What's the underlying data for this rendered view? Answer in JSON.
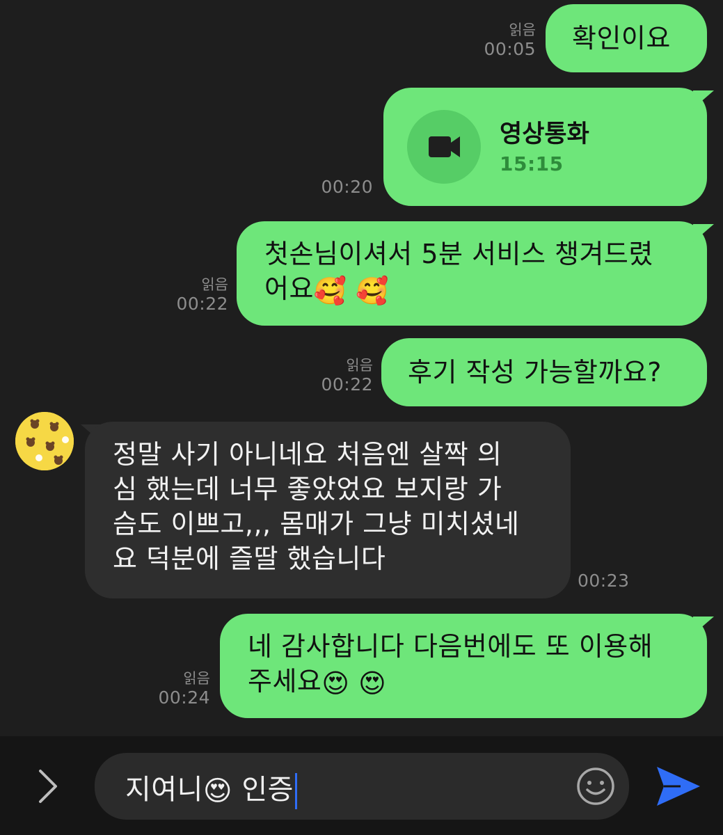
{
  "messages": [
    {
      "text": "확인이요",
      "read": "읽음",
      "time": "00:05"
    },
    {
      "call_title": "영상통화",
      "call_duration": "15:15",
      "time": "00:20"
    },
    {
      "line1": "첫손님이셔서 5분 서비스 챙겨드렸",
      "line2": "어요",
      "emoji": "🥰",
      "read": "읽음",
      "time": "00:22"
    },
    {
      "text": "후기 작성 가능할까요?",
      "read": "읽음",
      "time": "00:22"
    },
    {
      "line1": "정말 사기 아니네요 처음엔 살짝 의",
      "line2": "심 했는데 너무 좋았었요 보지랑 가",
      "line3": "슴도 이쁘고,,, 몸매가 그냥 미치셨네",
      "line4": "요 덕분에 즐딸 했습니다",
      "time": "00:23"
    },
    {
      "line1": "네 감사합니다 다음번에도 또 이용해",
      "line2": "주세요",
      "emoji": "😍",
      "read": "읽음",
      "time": "00:24"
    }
  ],
  "input": {
    "text_before": "지여니",
    "emoji": "😍",
    "text_after": "인증"
  },
  "icons": {
    "expand": "chevron-right-icon",
    "sticker": "smiley-icon",
    "send": "send-icon",
    "video": "video-camera-icon"
  },
  "colors": {
    "outgoing_bubble": "#6ee67a",
    "incoming_bubble": "#2e2e2e",
    "background": "#1e1e1e",
    "send_accent": "#2f6df6"
  }
}
